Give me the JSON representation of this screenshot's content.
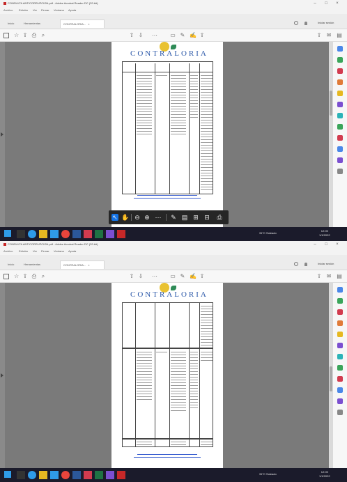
{
  "window": {
    "title": "CONSULTA ANTICORRUPCION.pdf - Adobe Acrobat Reader DC (32-bit)",
    "menu": [
      "Archivo",
      "Edición",
      "Ver",
      "Firmar",
      "Ventana",
      "Ayuda"
    ]
  },
  "tabs": {
    "home": "Inicio",
    "tools": "Herramientas",
    "doc": "CONTRALORIA...",
    "close": "×"
  },
  "header": {
    "signin": "Iniciar sesión"
  },
  "document": {
    "logo_text": "CONTRALORIA"
  },
  "taskbar": {
    "tray_text": "31°C  Soleado",
    "clock_time": "12:00",
    "clock_date": "1/1/2022"
  },
  "colors": {
    "viewer_bg": "#7a7a7a",
    "accent": "#1473e6",
    "logo_blue": "#2a57a8"
  },
  "icons": {
    "floating_toolbar": [
      "cursor-icon",
      "hand-icon",
      "zoom-out-icon",
      "zoom-in-icon",
      "more-icon",
      "comment-icon",
      "highlight-icon",
      "fit-page-icon",
      "read-mode-icon",
      "print-icon"
    ]
  }
}
